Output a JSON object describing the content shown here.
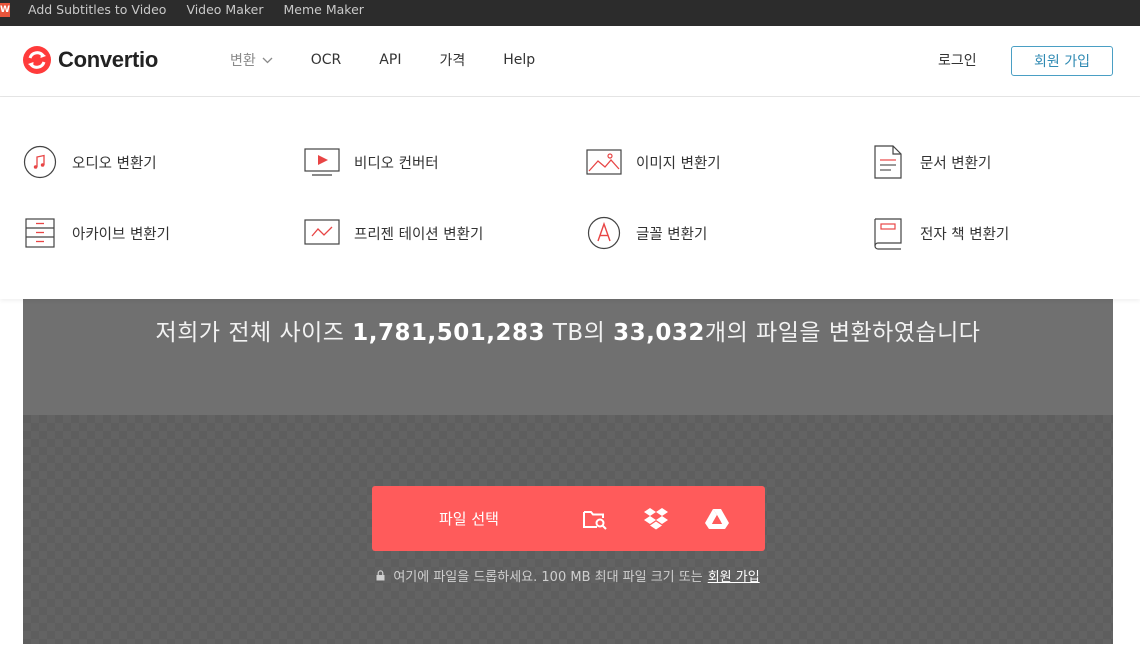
{
  "topbar": {
    "logo_letter": "W",
    "links": [
      "Add Subtitles to Video",
      "Video Maker",
      "Meme Maker"
    ]
  },
  "header": {
    "brand": "Convertio",
    "nav": [
      {
        "label": "변환",
        "has_dropdown": true
      },
      {
        "label": "OCR"
      },
      {
        "label": "API"
      },
      {
        "label": "가격"
      },
      {
        "label": "Help"
      }
    ],
    "login": "로그인",
    "signup": "회원 가입"
  },
  "menu": {
    "items": [
      {
        "label": "오디오 변환기",
        "icon": "audio-icon"
      },
      {
        "label": "비디오 컨버터",
        "icon": "video-icon"
      },
      {
        "label": "이미지 변환기",
        "icon": "image-icon"
      },
      {
        "label": "문서 변환기",
        "icon": "document-icon"
      },
      {
        "label": "아카이브 변환기",
        "icon": "archive-icon"
      },
      {
        "label": "프리젠 테이션 변환기",
        "icon": "presentation-icon"
      },
      {
        "label": "글꼴 변환기",
        "icon": "font-icon"
      },
      {
        "label": "전자 책 변환기",
        "icon": "ebook-icon"
      }
    ]
  },
  "hero": {
    "prefix": "저희가 전체 사이즈 ",
    "size": "1,781,501,283",
    "unit": " TB의 ",
    "count": "33,032",
    "suffix": "개의 파일을 변환하였습니다"
  },
  "upload": {
    "button_label": "파일 선택",
    "hint": "여기에 파일을 드롭하세요. 100 MB 최대 파일 크기 또는",
    "hint_link": "회원 가입"
  },
  "colors": {
    "brand_red": "#ff5b5b",
    "topbar_bg": "#2c2c2c",
    "signup_border": "#4a9fc4",
    "hero_bg": "#707070"
  }
}
